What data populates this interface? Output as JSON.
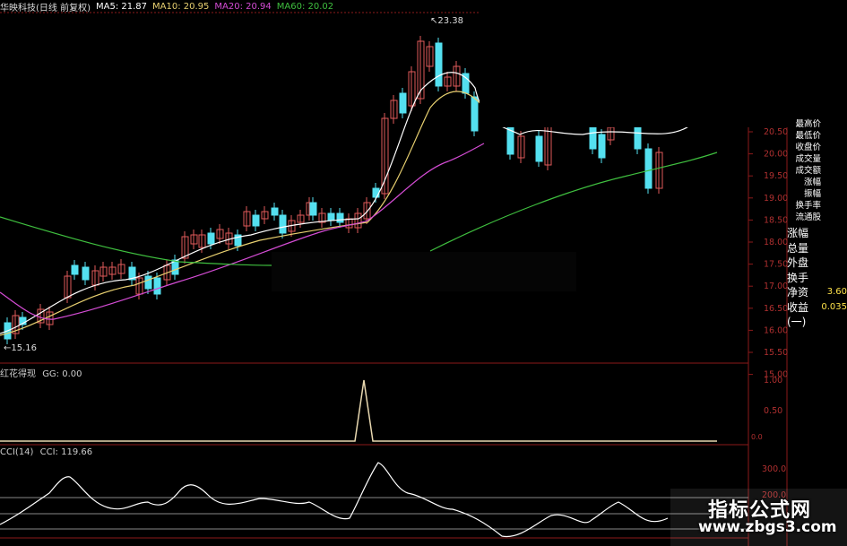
{
  "header": {
    "stock_label": "华映科技(日线 前复权)",
    "ma5": "MA5: 21.87",
    "ma10": "MA10: 20.95",
    "ma20": "MA20: 20.94",
    "ma60": "MA60: 20.02"
  },
  "colors": {
    "background": "#000000",
    "up_candle": "#e05a5a",
    "down_candle": "#54e0f0",
    "ma5": "#ffffff",
    "ma10": "#e8d070",
    "ma20": "#d44cd4",
    "ma60": "#3fbf3f",
    "grid": "#8b1a1a",
    "axis_text": "#b03030"
  },
  "main_chart": {
    "high_marker": "23.38",
    "low_marker": "15.16",
    "price_ticks": [
      "20.50",
      "20.00",
      "19.50",
      "19.00",
      "18.50",
      "18.00",
      "17.50",
      "17.00",
      "16.50",
      "16.00",
      "15.50",
      "15.00"
    ]
  },
  "indicator_panel": {
    "title": "红花得现",
    "value_label": "GG: 0.00",
    "ticks": [
      "1.00",
      "0.50"
    ],
    "tick_bottom": "0.0"
  },
  "cci_panel": {
    "title": "CCI(14)",
    "value_label": "CCI: 119.66",
    "ticks": [
      "300.0",
      "200.0"
    ]
  },
  "side_labels": [
    "最高价",
    "最低价",
    "收盘价",
    "成交量",
    "成交额",
    "涨幅",
    "振幅",
    "换手率",
    "流通股"
  ],
  "side_rows": [
    {
      "label": "涨幅",
      "value": ""
    },
    {
      "label": "总量",
      "value": ""
    },
    {
      "label": "外盘",
      "value": ""
    },
    {
      "label": "换手",
      "value": ""
    },
    {
      "label": "净资",
      "value": "3.60"
    },
    {
      "label": "收益(一)",
      "value": "0.035"
    }
  ],
  "watermark": {
    "line1": "指标公式网",
    "line2": "www.zbgs3.com"
  }
}
